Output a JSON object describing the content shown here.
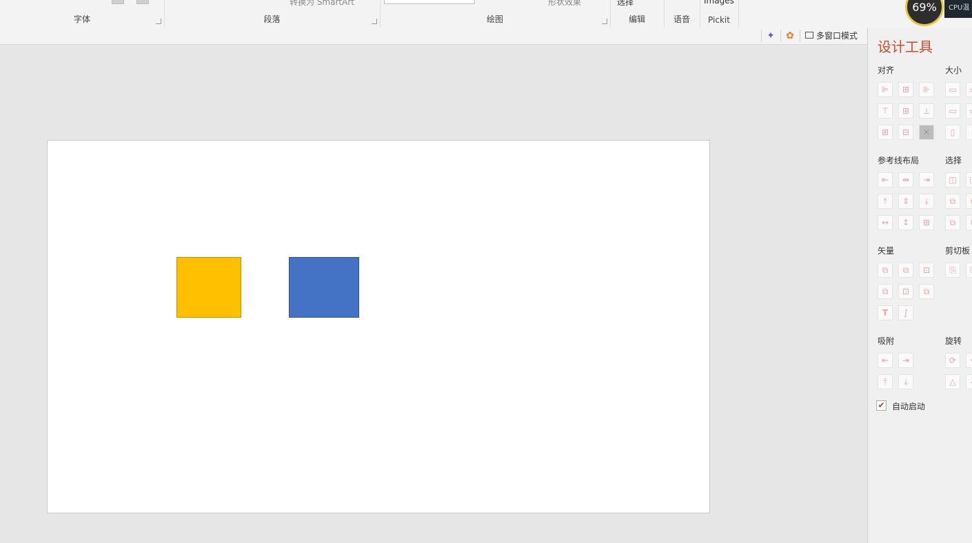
{
  "ribbon": {
    "groups": [
      {
        "label": "字体"
      },
      {
        "label": "段落"
      },
      {
        "label": "绘图"
      },
      {
        "label": "编辑"
      },
      {
        "label": "语音"
      },
      {
        "label": "Pickit"
      }
    ],
    "smartart_label": "转换为 SmartArt",
    "shape_effects_label": "形状效果",
    "select_label": "选择",
    "images_label": "Images"
  },
  "cpu": {
    "value": "69%",
    "label": "CPU温"
  },
  "subbar": {
    "multi_window_label": "多窗口模式"
  },
  "slide": {
    "shapes": [
      {
        "name": "yellow-rectangle",
        "fill": "#ffc000"
      },
      {
        "name": "blue-rectangle",
        "fill": "#4472c4"
      }
    ]
  },
  "design_pane": {
    "title": "设计工具",
    "sections": {
      "align": "对齐",
      "size": "大小",
      "guides": "参考线布局",
      "select": "选择",
      "vector": "矢量",
      "clipboard": "剪切板",
      "snap": "吸附",
      "rotate": "旋转"
    },
    "auto_start_label": "自动启动",
    "auto_start_checked": true
  },
  "colors": {
    "accent": "#d24726",
    "icon_tint": "#e9a3a3"
  }
}
